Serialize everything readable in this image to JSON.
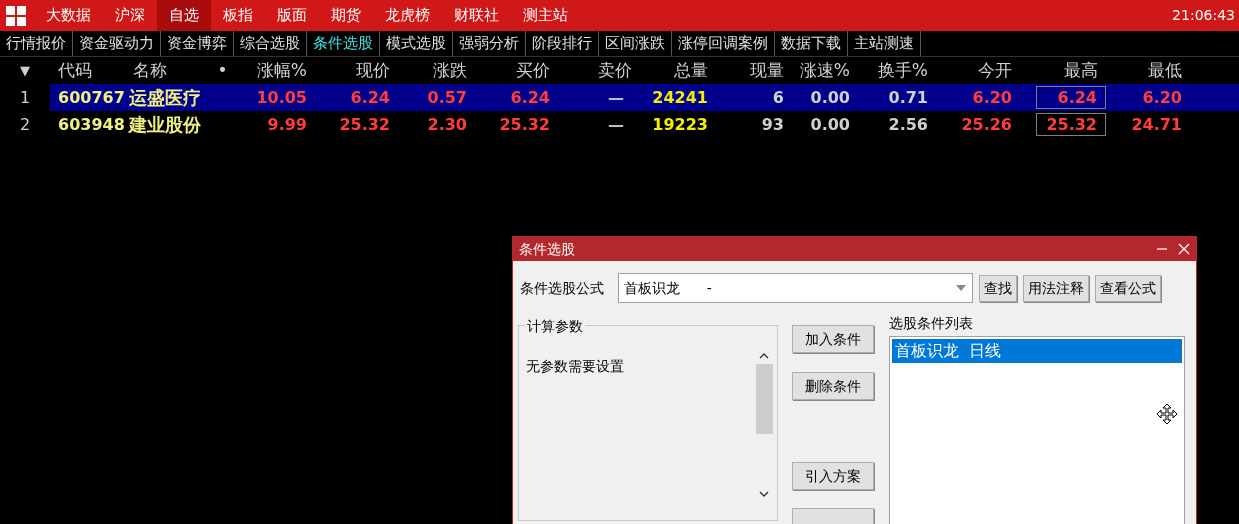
{
  "menu": [
    {
      "label": "大数据",
      "selected": false
    },
    {
      "label": "沪深",
      "selected": false
    },
    {
      "label": "自选",
      "selected": true
    },
    {
      "label": "板指",
      "selected": false
    },
    {
      "label": "版面",
      "selected": false
    },
    {
      "label": "期货",
      "selected": false
    },
    {
      "label": "龙虎榜",
      "selected": false
    },
    {
      "label": "财联社",
      "selected": false
    },
    {
      "label": "测主站",
      "selected": false
    }
  ],
  "clock": "21:06:43",
  "tabs": [
    {
      "label": "行情报价",
      "selected": false
    },
    {
      "label": "资金驱动力",
      "selected": false
    },
    {
      "label": "资金博弈",
      "selected": false
    },
    {
      "label": "综合选股",
      "selected": false
    },
    {
      "label": "条件选股",
      "selected": true
    },
    {
      "label": "模式选股",
      "selected": false
    },
    {
      "label": "强弱分析",
      "selected": false
    },
    {
      "label": "阶段排行",
      "selected": false
    },
    {
      "label": "区间涨跌",
      "selected": false
    },
    {
      "label": "涨停回调案例",
      "selected": false
    },
    {
      "label": "数据下载",
      "selected": false
    },
    {
      "label": "主站测速",
      "selected": false
    }
  ],
  "table": {
    "sort_icon": "▼",
    "columns": [
      {
        "label": "代码",
        "kind": "code"
      },
      {
        "label": "名称",
        "kind": "name"
      },
      {
        "label": "•",
        "kind": "dot"
      },
      {
        "label": "涨幅%",
        "kind": "up"
      },
      {
        "label": "现价",
        "kind": "up"
      },
      {
        "label": "涨跌",
        "kind": "up"
      },
      {
        "label": "买价",
        "kind": "up"
      },
      {
        "label": "卖价",
        "kind": "dash"
      },
      {
        "label": "总量",
        "kind": "volume"
      },
      {
        "label": "现量",
        "kind": "plain"
      },
      {
        "label": "涨速%",
        "kind": "plain"
      },
      {
        "label": "换手%",
        "kind": "plain"
      },
      {
        "label": "今开",
        "kind": "up"
      },
      {
        "label": "最高",
        "kind": "up",
        "boxed": true
      },
      {
        "label": "最低",
        "kind": "up"
      }
    ],
    "rows": [
      {
        "index": "1",
        "selected": true,
        "cells": [
          "600767",
          "运盛医疗",
          null,
          "10.05",
          "6.24",
          "0.57",
          "6.24",
          "—",
          "24241",
          "6",
          "0.00",
          "0.71",
          "6.20",
          "6.24",
          "6.20"
        ]
      },
      {
        "index": "2",
        "selected": false,
        "cells": [
          "603948",
          "建业股份",
          null,
          "9.99",
          "25.32",
          "2.30",
          "25.32",
          "—",
          "19223",
          "93",
          "0.00",
          "2.56",
          "25.26",
          "25.32",
          "24.71"
        ]
      }
    ]
  },
  "dialog": {
    "title": "条件选股",
    "formula_label": "条件选股公式",
    "formula_value": "首板识龙      -",
    "top_buttons": [
      "查找",
      "用法注释",
      "查看公式"
    ],
    "params_title": "计算参数",
    "params_text": "无参数需要设置",
    "side_buttons": [
      "加入条件",
      "删除条件",
      "引入方案"
    ],
    "list_label": "选股条件列表",
    "list_items": [
      {
        "label": "首板识龙  日线",
        "selected": true
      }
    ]
  }
}
